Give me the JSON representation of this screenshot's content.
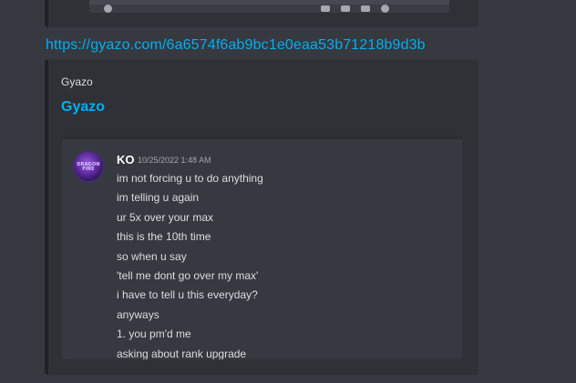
{
  "top_embed": {
    "icons": [
      "image-icon",
      "grid-icon",
      "file-icon",
      "info-icon"
    ]
  },
  "link": {
    "url": "https://gyazo.com/6a6574f6ab9bc1e0eaa53b71218b9d3b"
  },
  "embed": {
    "provider": "Gyazo",
    "title": "Gyazo",
    "screenshot": {
      "username": "KO",
      "timestamp": "10/25/2022 1:48 AM",
      "avatar_text": "DRAGON FIRE",
      "messages": [
        "im not forcing u to do anything",
        "im telling u  again",
        "ur 5x over your max",
        "this is the 10th time",
        "so when u say",
        "'tell me dont go over my max'",
        "i have to tell u this everyday?",
        "anyways",
        "1. you pm'd me",
        "asking about rank upgrade"
      ]
    }
  }
}
